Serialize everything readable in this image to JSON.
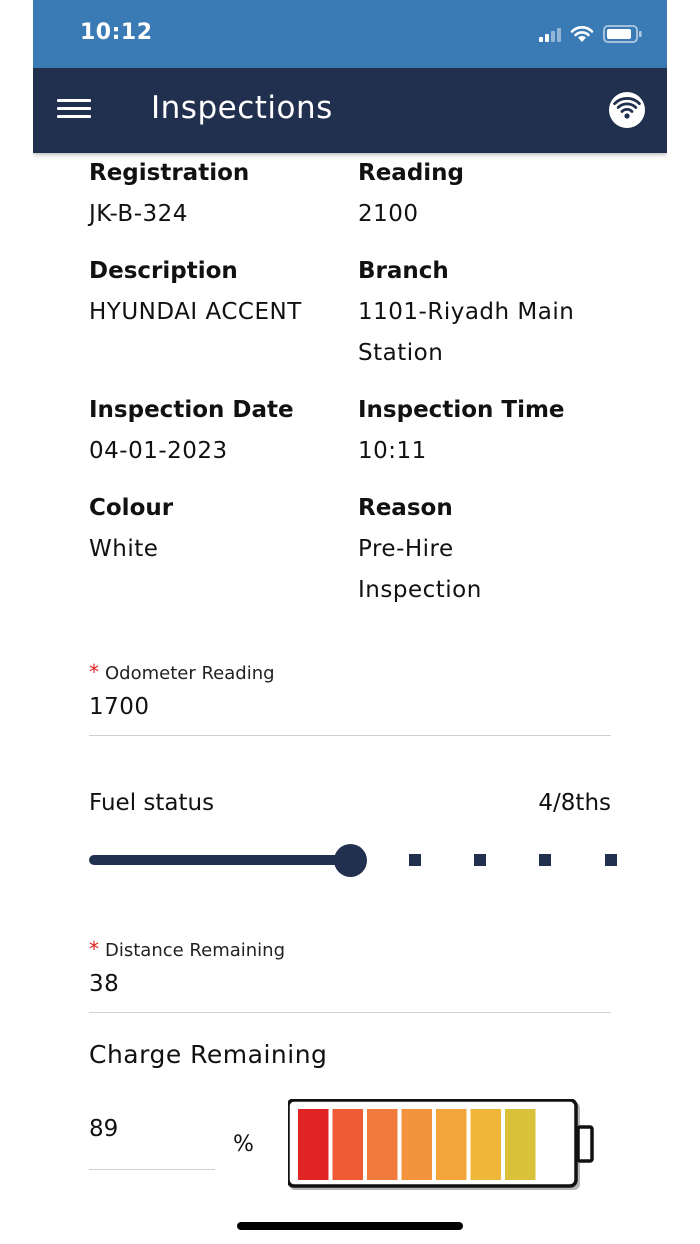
{
  "status_bar": {
    "time": "10:12"
  },
  "app_bar": {
    "title": "Inspections"
  },
  "details": [
    {
      "label": "Registration",
      "value": "JK-B-324"
    },
    {
      "label": "Reading",
      "value": "2100"
    },
    {
      "label": "Description",
      "value": "HYUNDAI ACCENT"
    },
    {
      "label": "Branch",
      "value_line1": "1101-Riyadh Main",
      "value_line2": "Station"
    },
    {
      "label": "Inspection Date",
      "value": "04-01-2023"
    },
    {
      "label": "Inspection Time",
      "value": "10:11"
    },
    {
      "label": "Colour",
      "value": "White"
    },
    {
      "label": "Reason",
      "value_line1": "Pre-Hire",
      "value_line2": "Inspection"
    }
  ],
  "odometer": {
    "required_mark": "*",
    "label": "Odometer Reading",
    "value": "1700"
  },
  "fuel": {
    "label": "Fuel status",
    "value_text": "4/8ths",
    "level": 4,
    "steps": 8
  },
  "distance": {
    "required_mark": "*",
    "label": "Distance Remaining",
    "value": "38"
  },
  "charge": {
    "label": "Charge Remaining",
    "value": "89",
    "unit": "%",
    "filled_segments": 7,
    "total_segments": 8
  },
  "colors": {
    "primary": "#22304f",
    "status_bar": "#3b7bb5",
    "required": "#e02020"
  },
  "icons": {
    "menu": "hamburger-menu-icon",
    "connection": "wifi-icon",
    "battery": "battery-icon"
  }
}
